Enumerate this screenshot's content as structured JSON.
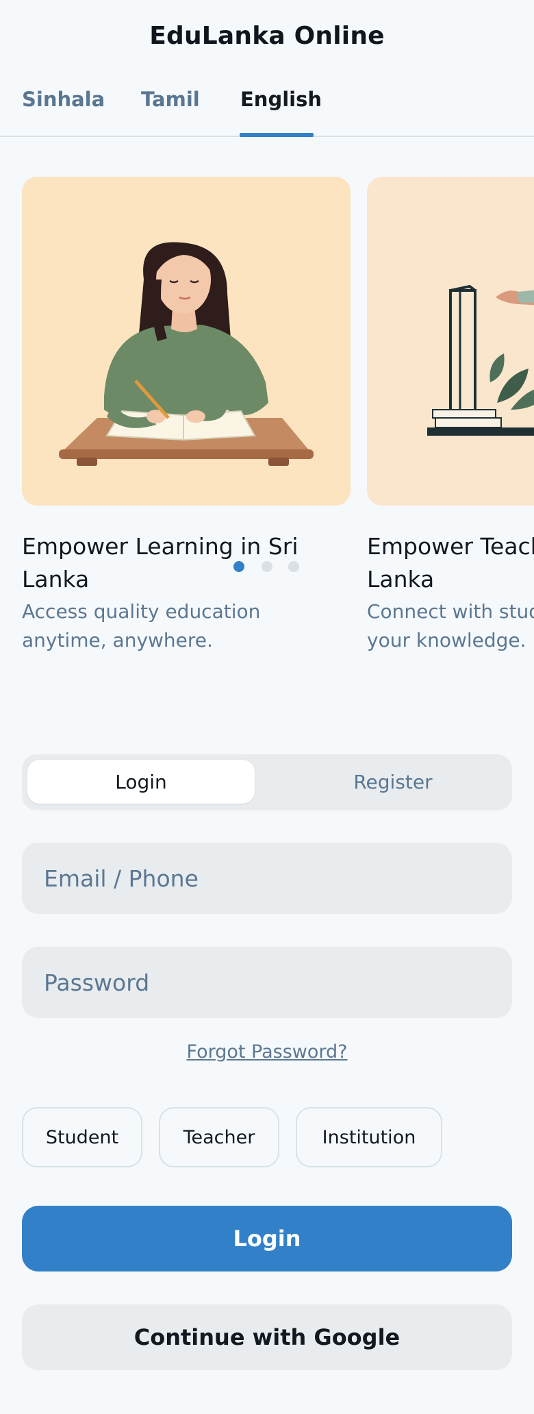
{
  "app": {
    "title": "EduLanka Online"
  },
  "language_tabs": [
    {
      "label": "Sinhala",
      "active": false
    },
    {
      "label": "Tamil",
      "active": false
    },
    {
      "label": "English",
      "active": true
    }
  ],
  "carousel": {
    "slides": [
      {
        "title": "Empower Learning in Sri Lanka",
        "description": "Access quality education anytime, anywhere.",
        "illustration": "student-studying-illustration"
      },
      {
        "title": "Empower Teaching in Sri Lanka",
        "description": "Connect with students and share your knowledge.",
        "illustration": "teacher-whiteboard-illustration"
      }
    ],
    "page_count": 3,
    "active_index": 0
  },
  "auth_toggle": {
    "login_label": "Login",
    "register_label": "Register",
    "active": "Login"
  },
  "form": {
    "email_placeholder": "Email / Phone",
    "password_placeholder": "Password",
    "forgot_label": "Forgot Password?"
  },
  "roles": [
    "Student",
    "Teacher",
    "Institution"
  ],
  "actions": {
    "login_label": "Login",
    "google_label": "Continue with Google"
  },
  "colors": {
    "accent": "#3281c8",
    "background": "#f6f9fb",
    "muted_text": "#5b7791",
    "field_bg": "#e8ecef",
    "card_bg": "#fbe4bf"
  }
}
